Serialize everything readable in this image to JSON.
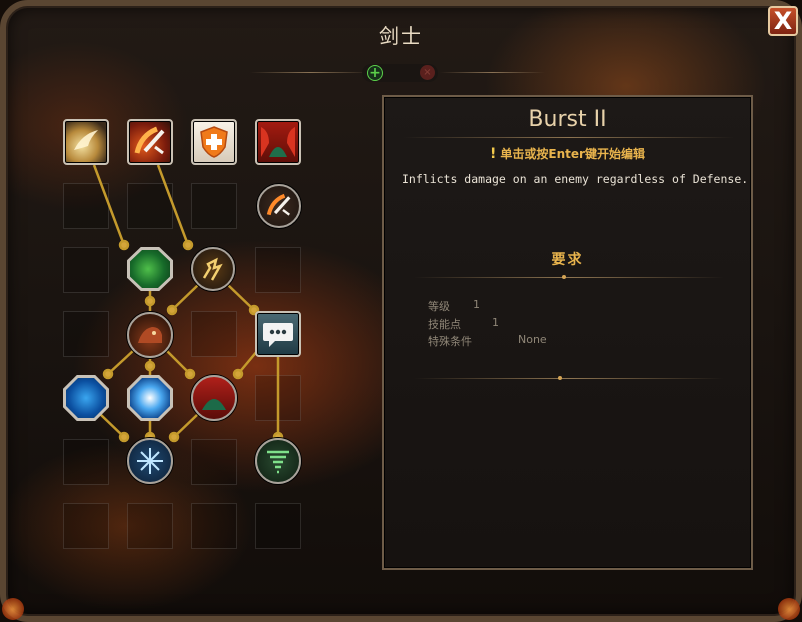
{
  "window": {
    "title": "剑士",
    "close_label": "X"
  },
  "toolbar": {
    "add_label": "+",
    "delete_label": "×"
  },
  "skill_tree": {
    "skills": [
      {
        "id": "s1",
        "name": "flying-slash-icon",
        "shape": "square"
      },
      {
        "id": "s2",
        "name": "sword-flame-icon",
        "shape": "square"
      },
      {
        "id": "s3",
        "name": "shield-cross-icon",
        "shape": "square"
      },
      {
        "id": "s4",
        "name": "red-curtain-icon",
        "shape": "square"
      },
      {
        "id": "s5",
        "name": "sword-flame-small-icon",
        "shape": "circle"
      },
      {
        "id": "s6",
        "name": "green-splatter-icon",
        "shape": "oct"
      },
      {
        "id": "s7",
        "name": "lightning-runner-icon",
        "shape": "circle"
      },
      {
        "id": "s8",
        "name": "beast-charge-icon",
        "shape": "circle"
      },
      {
        "id": "s9",
        "name": "chat-bubble-icon",
        "shape": "square"
      },
      {
        "id": "s10",
        "name": "blue-wave-icon",
        "shape": "oct"
      },
      {
        "id": "s11",
        "name": "fist-burst-icon",
        "shape": "oct"
      },
      {
        "id": "s12",
        "name": "fire-mountain-icon",
        "shape": "circle"
      },
      {
        "id": "s13",
        "name": "snowflake-icon",
        "shape": "circle"
      },
      {
        "id": "s14",
        "name": "green-tornado-icon",
        "shape": "circle"
      }
    ]
  },
  "detail": {
    "skill_name": "Burst II",
    "hint_icon": "!",
    "hint": "单击或按Enter键开始编辑",
    "description": "Inflicts damage on an enemy regardless of Defense.",
    "requirements_title": "要求",
    "requirements": [
      {
        "label": "等级",
        "value": "1"
      },
      {
        "label": "技能点",
        "value": "1"
      },
      {
        "label": "特殊条件",
        "value": "None"
      }
    ]
  }
}
